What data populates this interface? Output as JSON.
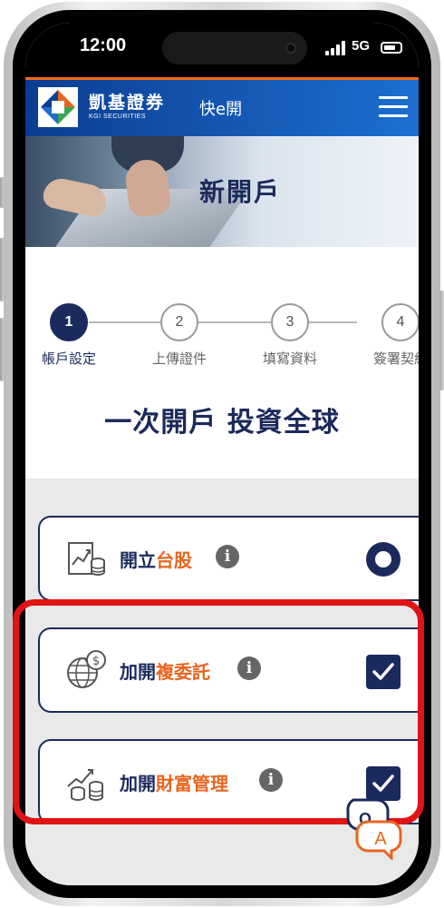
{
  "status_bar": {
    "time": "12:00",
    "network": "5G"
  },
  "header": {
    "brand_cn": "凱基證券",
    "brand_en": "KGI SECURITIES",
    "app_name": "快e開",
    "menu_icon": "hamburger-menu-icon"
  },
  "banner": {
    "title": "新開戶"
  },
  "steps": [
    {
      "number": "1",
      "label": "帳戶設定",
      "active": true
    },
    {
      "number": "2",
      "label": "上傳證件",
      "active": false
    },
    {
      "number": "3",
      "label": "填寫資料",
      "active": false
    },
    {
      "number": "4",
      "label": "簽署契約",
      "active": false
    }
  ],
  "tagline": "一次開戶 投資全球",
  "options": [
    {
      "prefix": "開立",
      "highlight": "台股",
      "icon": "stock-chart-coins-icon",
      "control": "radio",
      "selected": true
    },
    {
      "prefix": "加開",
      "highlight": "複委託",
      "icon": "globe-dollar-icon",
      "control": "checkbox",
      "checked": true
    },
    {
      "prefix": "加開",
      "highlight": "財富管理",
      "icon": "growth-coins-icon",
      "control": "checkbox",
      "checked": true
    }
  ],
  "chat_badge": "A",
  "colors": {
    "navy": "#1b2a5c",
    "orange": "#e8651e",
    "highlight_red": "#e01414",
    "header_blue": "#0b3d91"
  }
}
